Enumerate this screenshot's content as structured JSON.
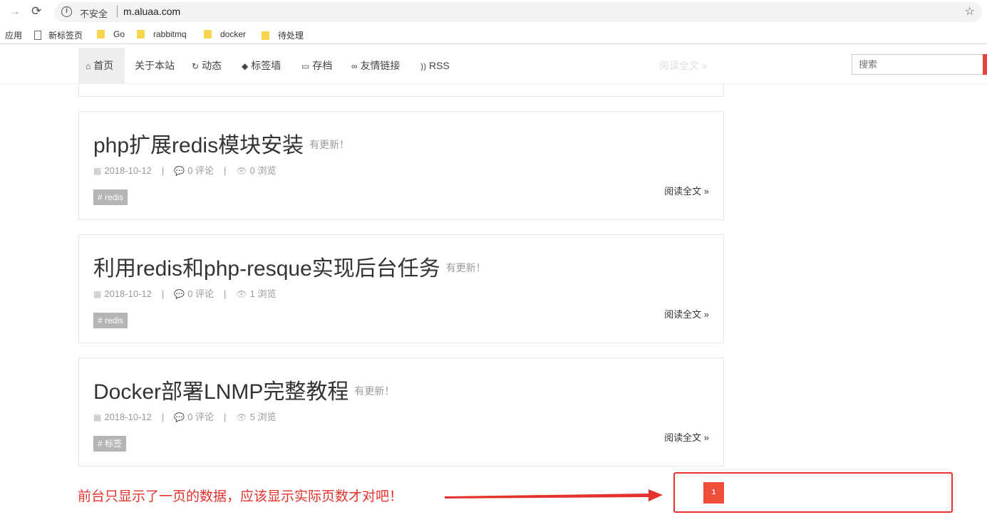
{
  "browser": {
    "insecure_label": "不安全",
    "url": "m.aluaa.com",
    "bookmarks": [
      {
        "label": "应用",
        "icon": "apps-icon"
      },
      {
        "label": "新标签页",
        "icon": "page-icon"
      },
      {
        "label": "Go",
        "icon": "folder-icon"
      },
      {
        "label": "rabbitmq",
        "icon": "folder-icon"
      },
      {
        "label": "docker",
        "icon": "folder-icon"
      },
      {
        "label": "待处理",
        "icon": "folder-icon"
      }
    ]
  },
  "nav": {
    "items": [
      {
        "label": "首页",
        "icon": "home-icon",
        "active": true
      },
      {
        "label": "关于本站",
        "icon": "",
        "active": false
      },
      {
        "label": "动态",
        "icon": "refresh-icon",
        "active": false
      },
      {
        "label": "标签墙",
        "icon": "tags-icon",
        "active": false
      },
      {
        "label": "存档",
        "icon": "inbox-icon",
        "active": false
      },
      {
        "label": "友情链接",
        "icon": "link-icon",
        "active": false
      },
      {
        "label": "RSS",
        "icon": "rss-icon",
        "active": false
      }
    ],
    "ghost_text": "阅读全文 »",
    "search_placeholder": "搜索"
  },
  "posts": [
    {
      "title": "php扩展redis模块安装",
      "update_badge": "有更新！",
      "date": "2018-10-12",
      "comments": "0 评论",
      "views": "0 浏览",
      "tag": "# redis",
      "read_more": "阅读全文 »"
    },
    {
      "title": "利用redis和php-resque实现后台任务",
      "update_badge": "有更新！",
      "date": "2018-10-12",
      "comments": "0 评论",
      "views": "1 浏览",
      "tag": "# redis",
      "read_more": "阅读全文 »"
    },
    {
      "title": "Docker部署LNMP完整教程",
      "update_badge": "有更新！",
      "date": "2018-10-12",
      "comments": "0 评论",
      "views": "5 浏览",
      "tag": "# 标签",
      "read_more": "阅读全文 »"
    }
  ],
  "annotation": {
    "note": "前台只显示了一页的数据，应该显示实际页数才对吧！",
    "color": "#e5322d"
  },
  "pagination": {
    "current_page": "1",
    "color": "#f04d3b"
  }
}
